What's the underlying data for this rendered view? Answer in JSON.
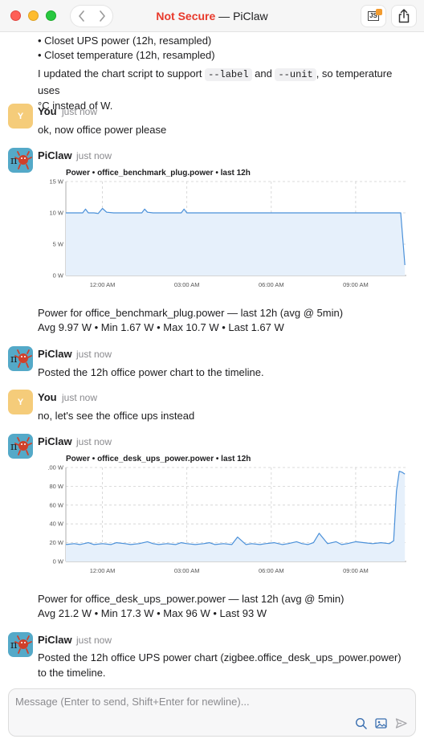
{
  "window": {
    "insecure_label": "Not Secure",
    "separator": "—",
    "app_name": "PiClaw"
  },
  "icons": {
    "back": "chevron-left-icon",
    "forward": "chevron-right-icon",
    "js": "js-toggle-icon",
    "share": "share-icon",
    "search": "search-icon",
    "image": "image-icon",
    "send": "send-icon"
  },
  "colors": {
    "not_secure": "#e8392b",
    "user_avatar": "#f5cc7a",
    "bot_avatar": "#54a9c8",
    "chart_line": "#4a90d9",
    "chart_fill": "#e6f0fb"
  },
  "prior": {
    "bullet1": "• Closet UPS power (12h, resampled)",
    "bullet2": "• Closet temperature (12h, resampled)",
    "text_a": "I updated the chart script to support ",
    "code1": "--label",
    "text_b": " and ",
    "code2": "--unit",
    "text_c": ", so temperature uses",
    "text_d": "°C instead of W."
  },
  "messages": [
    {
      "avatar": "Y",
      "sender": "You",
      "time": "just now",
      "text": "ok, now office power please"
    },
    {
      "avatar": "",
      "sender": "PiClaw",
      "time": "just now",
      "caption1": "Power for office_benchmark_plug.power — last 12h (avg @ 5min)",
      "caption2": "Avg 9.97 W • Min 1.67 W • Max 10.7 W • Last 1.67 W"
    },
    {
      "avatar": "",
      "sender": "PiClaw",
      "time": "just now",
      "text": "Posted the 12h office power chart to the timeline."
    },
    {
      "avatar": "Y",
      "sender": "You",
      "time": "just now",
      "text": "no, let's see the office ups instead"
    },
    {
      "avatar": "",
      "sender": "PiClaw",
      "time": "just now",
      "caption1": "Power for office_desk_ups_power.power — last 12h (avg @ 5min)",
      "caption2": "Avg 21.2 W • Min 17.3 W • Max 96 W • Last 93 W"
    },
    {
      "avatar": "",
      "sender": "PiClaw",
      "time": "just now",
      "text": "Posted the 12h office UPS power chart (zigbee.office_desk_ups_power.power) to the timeline."
    }
  ],
  "composer": {
    "placeholder": "Message (Enter to send, Shift+Enter for newline)..."
  },
  "chart_data": [
    {
      "type": "area",
      "title": "Power • office_benchmark_plug.power • last 12h",
      "x_ticks": [
        "12:00 AM",
        "03:00 AM",
        "06:00 AM",
        "09:00 AM"
      ],
      "y_ticks": [
        "0 W",
        "5 W",
        "10 W",
        "15 W"
      ],
      "ylim": [
        0,
        15
      ],
      "x_range_hours": [
        -1.3,
        10.8
      ],
      "grid": true,
      "series": [
        {
          "x": [
            -1.3,
            -0.7,
            -0.6,
            -0.5,
            -0.3,
            -0.15,
            0.0,
            0.15,
            0.4,
            1.4,
            1.5,
            1.6,
            1.8,
            2.8,
            2.9,
            3.0,
            3.3,
            4.0,
            6.0,
            8.0,
            10.0,
            10.6,
            10.75
          ],
          "y": [
            10.0,
            10.0,
            10.6,
            10.0,
            10.0,
            9.9,
            10.7,
            10.1,
            10.0,
            10.0,
            10.6,
            10.1,
            10.0,
            10.0,
            10.6,
            10.0,
            10.0,
            10.0,
            10.0,
            10.0,
            10.0,
            10.0,
            1.67
          ]
        }
      ]
    },
    {
      "type": "area",
      "title": "Power • office_desk_ups_power.power • last 12h",
      "x_ticks": [
        "12:00 AM",
        "03:00 AM",
        "06:00 AM",
        "09:00 AM"
      ],
      "y_ticks": [
        "0 W",
        "20 W",
        "40 W",
        "60 W",
        "80 W",
        "100 W"
      ],
      "ylim": [
        0,
        100
      ],
      "x_range_hours": [
        -1.3,
        10.8
      ],
      "grid": true,
      "series": [
        {
          "x": [
            -1.3,
            -1.0,
            -0.8,
            -0.5,
            -0.3,
            0.0,
            0.3,
            0.5,
            0.8,
            1.0,
            1.3,
            1.6,
            1.8,
            2.0,
            2.3,
            2.6,
            2.8,
            3.0,
            3.3,
            3.6,
            3.8,
            4.0,
            4.3,
            4.6,
            4.8,
            5.1,
            5.3,
            5.6,
            5.8,
            6.1,
            6.4,
            6.6,
            6.9,
            7.1,
            7.3,
            7.5,
            7.7,
            8.0,
            8.3,
            8.5,
            8.7,
            9.0,
            9.3,
            9.6,
            9.9,
            10.2,
            10.35,
            10.45,
            10.55,
            10.65,
            10.75
          ],
          "y": [
            18,
            19,
            18,
            20,
            18,
            19,
            18,
            20,
            19,
            18,
            19,
            21,
            19,
            18,
            19,
            18,
            20,
            19,
            18,
            19,
            20,
            18,
            19,
            18,
            26,
            18,
            19,
            18,
            19,
            20,
            18,
            19,
            21,
            19,
            18,
            20,
            30,
            19,
            21,
            18,
            19,
            21,
            20,
            19,
            20,
            19,
            22,
            75,
            96,
            95,
            93
          ]
        }
      ]
    }
  ]
}
